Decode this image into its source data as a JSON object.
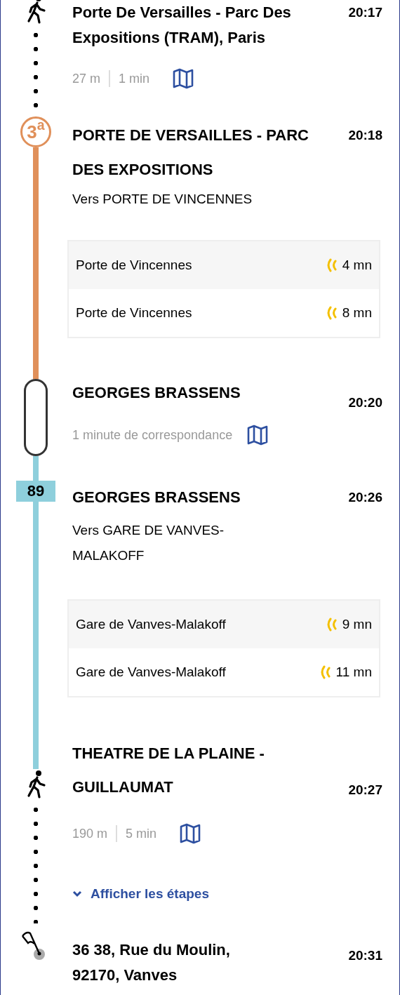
{
  "segments": [
    {
      "kind": "walk",
      "stop": "Porte De Versailles - Parc Des Expositions (TRAM), Paris",
      "time": "20:17",
      "distance": "27 m",
      "duration": "1 min"
    },
    {
      "kind": "tram",
      "line": "3$^{a}$",
      "color": "#e0905a",
      "stop": "PORTE DE VERSAILLES - PARC DES EXPOSITIONS",
      "time": "20:18",
      "direction": "Vers PORTE DE VINCENNES",
      "departures": [
        {
          "destination": "Porte de Vincennes",
          "wait": "4 mn"
        },
        {
          "destination": "Porte de Vincennes",
          "wait": "8 mn"
        }
      ]
    },
    {
      "kind": "transfer",
      "stop": "GEORGES BRASSENS",
      "time": "20:20",
      "note": "1 minute de correspondance"
    },
    {
      "kind": "bus",
      "line": "89",
      "color": "#8ecfdc",
      "stop": "GEORGES BRASSENS",
      "time": "20:26",
      "direction": "Vers GARE DE VANVES-MALAKOFF",
      "departures": [
        {
          "destination": "Gare de Vanves-Malakoff",
          "wait": "9 mn"
        },
        {
          "destination": "Gare de Vanves-Malakoff",
          "wait": "11 mn"
        }
      ]
    },
    {
      "kind": "walk",
      "stop": "THEATRE DE LA PLAINE - GUILLAUMAT",
      "time": "20:27",
      "distance": "190 m",
      "duration": "5 min",
      "steps_link": "Afficher les étapes"
    },
    {
      "kind": "destination",
      "stop": "36 38, Rue du Moulin, 92170, Vanves",
      "time": "20:31"
    }
  ]
}
